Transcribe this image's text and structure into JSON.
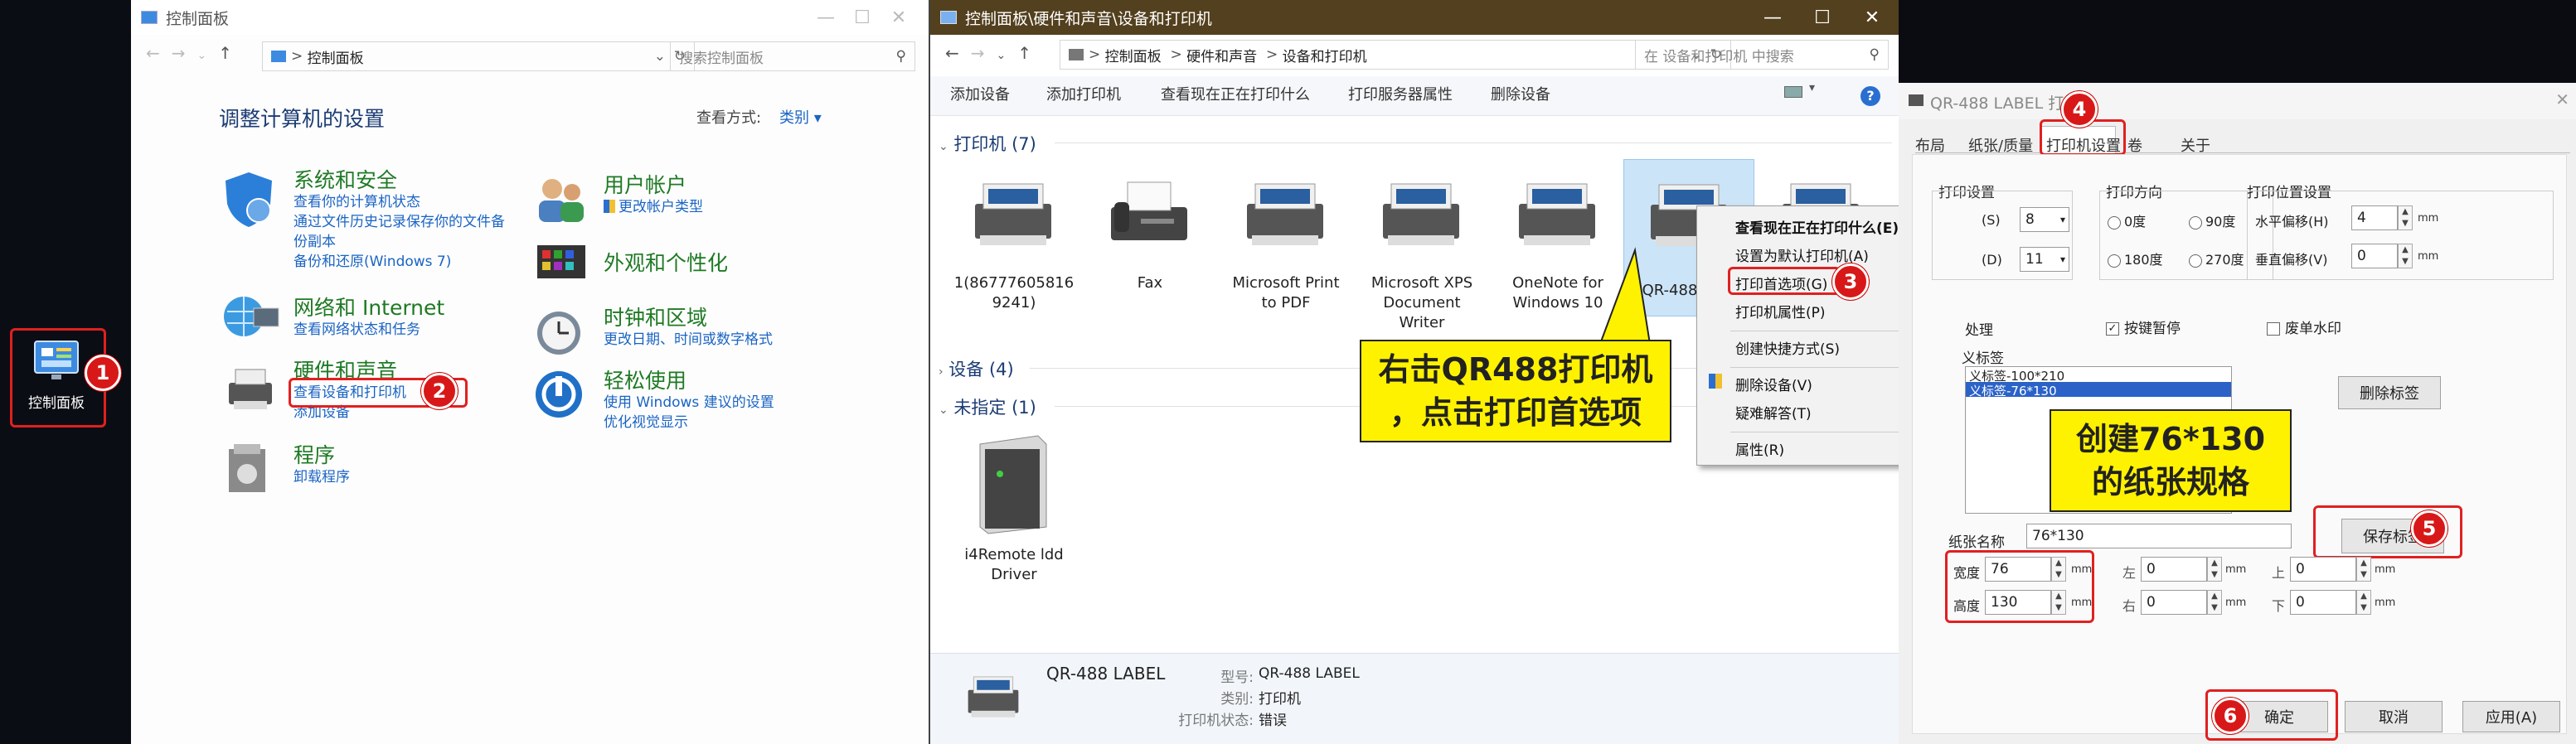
{
  "desktop": {
    "icon_label": "控制面板",
    "badge": "1"
  },
  "control_panel": {
    "title": "控制面板",
    "address": "控制面板",
    "search_placeholder": "搜索控制面板",
    "heading": "调整计算机的设置",
    "view_by_label": "查看方式:",
    "view_by_value": "类别",
    "left": [
      {
        "title": "系统和安全",
        "links": [
          "查看你的计算机状态",
          "通过文件历史记录保存你的文件备",
          "份副本",
          "备份和还原(Windows 7)"
        ]
      },
      {
        "title": "网络和 Internet",
        "links": [
          "查看网络状态和任务"
        ]
      },
      {
        "title": "硬件和声音",
        "links": [
          "查看设备和打印机",
          "添加设备"
        ]
      },
      {
        "title": "程序",
        "links": [
          "卸载程序"
        ]
      }
    ],
    "right": [
      {
        "title": "用户帐户",
        "links": [
          "更改帐户类型"
        ]
      },
      {
        "title": "外观和个性化",
        "links": []
      },
      {
        "title": "时钟和区域",
        "links": [
          "更改日期、时间或数字格式"
        ]
      },
      {
        "title": "轻松使用",
        "links": [
          "使用 Windows 建议的设置",
          "优化视觉显示"
        ]
      }
    ],
    "badge": "2"
  },
  "devices": {
    "title": "控制面板\\硬件和声音\\设备和打印机",
    "breadcrumb": [
      "控制面板",
      "硬件和声音",
      "设备和打印机"
    ],
    "search_placeholder": "在 设备和打印机 中搜索",
    "commands": [
      "添加设备",
      "添加打印机",
      "查看现在正在打印什么",
      "打印服务器属性",
      "删除设备"
    ],
    "printers_header": "打印机 (7)",
    "printers": [
      "1(86777605816\n9241)",
      "Fax",
      "Microsoft Print\nto PDF",
      "Microsoft XPS\nDocument\nWriter",
      "OneNote for\nWindows 10",
      "QR-488"
    ],
    "devices_header": "设备 (4)",
    "unspecified_header": "未指定 (1)",
    "unspecified": [
      "i4Remote ldd\nDriver"
    ],
    "detail_name": "QR-488 LABEL",
    "detail_model_label": "型号:",
    "detail_model": "QR-488 LABEL",
    "detail_category_label": "类别:",
    "detail_category": "打印机",
    "detail_status_label": "打印机状态:",
    "detail_status": "错误"
  },
  "context_menu": {
    "items": [
      "查看现在正在打印什么(E)",
      "设置为默认打印机(A)",
      "打印首选项(G)",
      "打印机属性(P)",
      "创建快捷方式(S)",
      "删除设备(V)",
      "疑难解答(T)",
      "属性(R)"
    ],
    "badge": "3"
  },
  "callout1": {
    "line1": "右击QR488打印机",
    "line2": "，点击打印首选项"
  },
  "callout2": {
    "line1": "创建76*130",
    "line2": "的纸张规格"
  },
  "dialog": {
    "title": "QR-488 LABEL 打...",
    "tabs": [
      "布局",
      "纸张/质量",
      "打印机设置",
      "卷",
      "关于"
    ],
    "badge4": "4",
    "print_settings": "打印设置",
    "speed_label": "(S)",
    "speed_value": "8",
    "density_label": "(D)",
    "density_value": "11",
    "direction_label": "打印方向",
    "dir_options": [
      "0度",
      "90度",
      "180度",
      "270度"
    ],
    "position_label": "打印位置设置",
    "h_offset_label": "水平偏移(H)",
    "h_offset": "4",
    "v_offset_label": "垂直偏移(V)",
    "v_offset": "0",
    "unit": "mm",
    "process_label": "处理",
    "pause_key": "按键暂停",
    "watermark": "废单水印",
    "custom_label": "义标签",
    "list_items": [
      "义标签-100*210",
      "义标签-76*130"
    ],
    "delete_label": "删除标签",
    "paper_name_label": "纸张名称",
    "paper_name": "76*130",
    "save_label": "保存标签",
    "badge5": "5",
    "width_label": "宽度",
    "width": "76",
    "height_label": "高度",
    "height": "130",
    "left_label": "左",
    "left": "0",
    "right_label": "右",
    "right": "0",
    "top_label": "上",
    "top": "0",
    "bottom_label": "下",
    "bottom": "0",
    "ok": "确定",
    "cancel": "取消",
    "apply": "应用(A)",
    "badge6": "6"
  },
  "colors": {
    "accent": "#1a64c4",
    "badge": "#d81818",
    "callout": "#fff200",
    "category_green": "#1e7a24"
  }
}
